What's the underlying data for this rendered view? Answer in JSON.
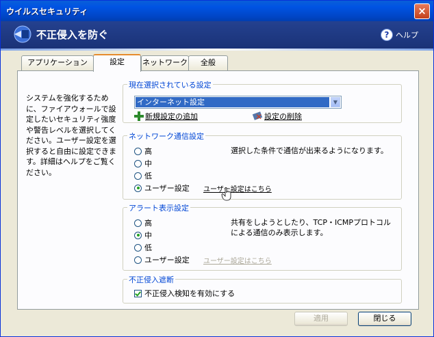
{
  "window": {
    "title": "ウイルスセキュリティ",
    "close_label": "×"
  },
  "header": {
    "title": "不正侵入を防ぐ",
    "help_label": "ヘルプ",
    "help_icon": "?"
  },
  "tabs": [
    {
      "label": "アプリケーション",
      "active": false
    },
    {
      "label": "設定",
      "active": true
    },
    {
      "label": "ネットワーク",
      "active": false
    },
    {
      "label": "全般",
      "active": false
    }
  ],
  "description": "システムを強化するために、ファイアウォールで設定したいセキュリティ強度や警告レベルを選択してください。ユーザー設定を選択すると自由に設定できます。詳細はヘルプをご覧ください。",
  "current_setting": {
    "title": "現在選択されている設定",
    "selected": "インターネット設定",
    "add_label": "新規設定の追加",
    "delete_label": "設定の削除"
  },
  "network": {
    "title": "ネットワーク通信設定",
    "options": [
      "高",
      "中",
      "低",
      "ユーザー設定"
    ],
    "selected_index": 3,
    "info": "選択した条件で通信が出来るようになります。",
    "user_link": "ユーザー設定はこちら"
  },
  "alert": {
    "title": "アラート表示設定",
    "options": [
      "高",
      "中",
      "低",
      "ユーザー設定"
    ],
    "selected_index": 1,
    "info": "共有をしようとしたり、TCP・ICMPプロトコルによる通信のみ表示します。",
    "user_link": "ユーザー設定はこちら"
  },
  "block": {
    "title": "不正侵入遮断",
    "checkbox_label": "不正侵入検知を有効にする",
    "checked": true
  },
  "buttons": {
    "apply": "適用",
    "close": "閉じる"
  },
  "icons": [
    "close-icon",
    "shield-logo-icon",
    "help-icon",
    "dropdown-arrow-icon",
    "add-plus-icon",
    "delete-icon",
    "hand-cursor-icon",
    "checkmark-icon"
  ]
}
